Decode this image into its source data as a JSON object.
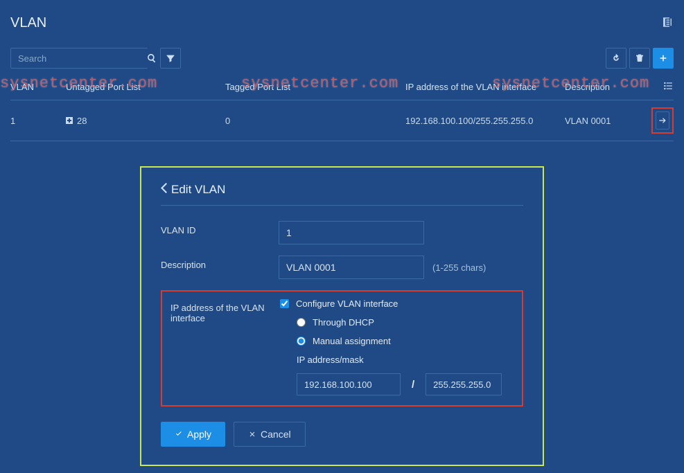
{
  "page": {
    "title": "VLAN"
  },
  "search": {
    "placeholder": "Search"
  },
  "table": {
    "headers": {
      "vlan": "VLAN",
      "untagged": "Untagged Port List",
      "tagged": "Tagged Port List",
      "ip": "IP address of the VLAN interface",
      "desc": "Description"
    },
    "rows": [
      {
        "vlan": "1",
        "untagged": "28",
        "tagged": "0",
        "ip": "192.168.100.100/255.255.255.0",
        "desc": "VLAN 0001"
      }
    ]
  },
  "panel": {
    "title": "Edit VLAN",
    "labels": {
      "vlan_id": "VLAN ID",
      "description": "Description",
      "ip_section": "IP address of the VLAN interface",
      "configure": "Configure VLAN interface",
      "dhcp": "Through DHCP",
      "manual": "Manual assignment",
      "ip_mask": "IP address/mask",
      "hint": "(1-255 chars)"
    },
    "values": {
      "vlan_id": "1",
      "description": "VLAN 0001",
      "ip": "192.168.100.100",
      "mask": "255.255.255.0"
    },
    "buttons": {
      "apply": "Apply",
      "cancel": "Cancel"
    }
  },
  "watermark": "sysnetcenter.com"
}
